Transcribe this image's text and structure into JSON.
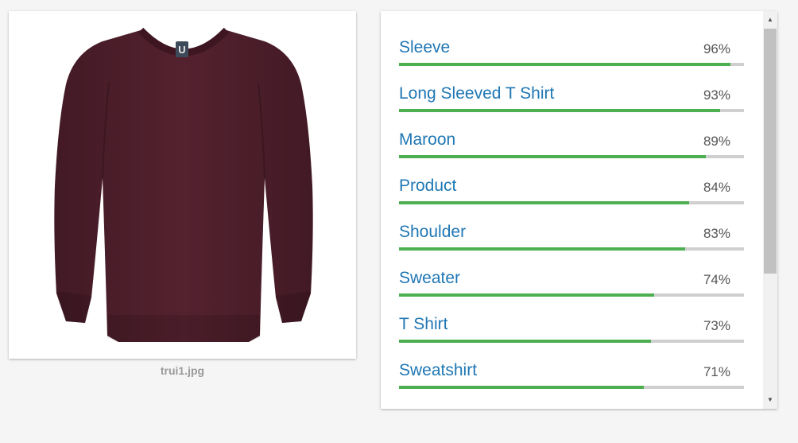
{
  "image": {
    "filename": "trui1.jpg",
    "logo_text": "U",
    "sweater_color": "#54212f"
  },
  "accent": {
    "label_color": "#1f77b4",
    "bar_color": "#4caf50",
    "track_color": "#cfcfcf"
  },
  "labels": [
    {
      "name": "Sleeve",
      "percent": "96%",
      "score": 0.96
    },
    {
      "name": "Long Sleeved T Shirt",
      "percent": "93%",
      "score": 0.93
    },
    {
      "name": "Maroon",
      "percent": "89%",
      "score": 0.89
    },
    {
      "name": "Product",
      "percent": "84%",
      "score": 0.84
    },
    {
      "name": "Shoulder",
      "percent": "83%",
      "score": 0.83
    },
    {
      "name": "Sweater",
      "percent": "74%",
      "score": 0.74
    },
    {
      "name": "T Shirt",
      "percent": "73%",
      "score": 0.73
    },
    {
      "name": "Sweatshirt",
      "percent": "71%",
      "score": 0.71
    }
  ],
  "scrollbar": {
    "up_icon": "arrow-up-icon",
    "down_icon": "arrow-down-icon"
  }
}
